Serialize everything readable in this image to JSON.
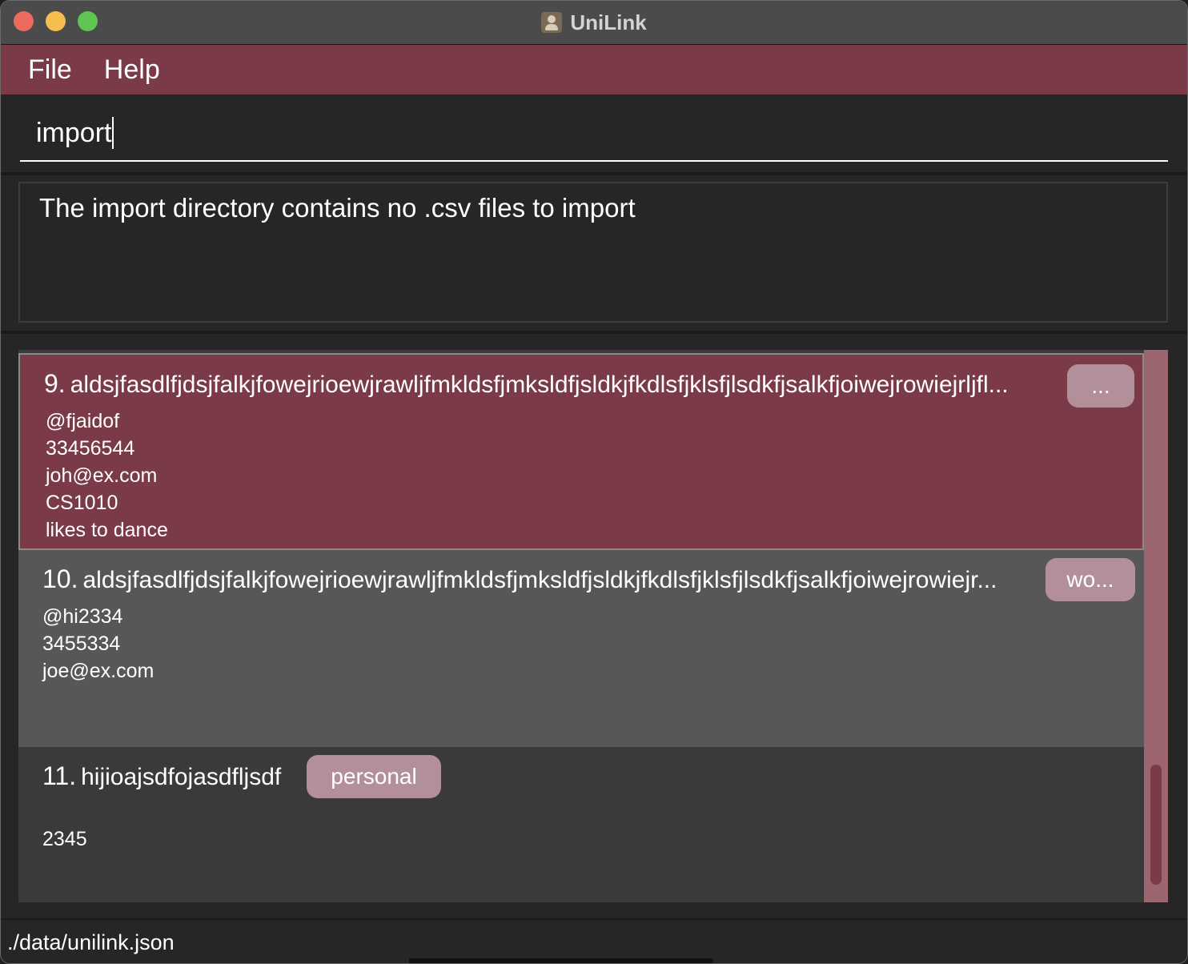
{
  "window": {
    "title": "UniLink"
  },
  "menu": {
    "items": [
      "File",
      "Help"
    ]
  },
  "command": {
    "value": "import"
  },
  "result": {
    "message": "The import directory contains no .csv files to import"
  },
  "persons": [
    {
      "index": "9.",
      "name": "aldsjfasdlfjdsjfalkjfowejrioewjrawljfmkldsfjmksldfjsldkjfkdlsfjklsfjlsdkfjsalkfjoiwejrowiejrljfl...",
      "tag": "...",
      "telegram": "@fjaidof",
      "phone": "33456544",
      "email": "joh@ex.com",
      "module": "CS1010",
      "remark": "likes to dance"
    },
    {
      "index": "10.",
      "name": "aldsjfasdlfjdsjfalkjfowejrioewjrawljfmkldsfjmksldfjsldkjfkdlsfjklsfjlsdkfjsalkfjoiwejrowiejr...",
      "tag": "wo...",
      "telegram": "@hi2334",
      "phone": "3455334",
      "email": "joe@ex.com"
    },
    {
      "index": "11.",
      "name": "hijioajsdfojasdfljsdf",
      "tag": "personal",
      "phone": "2345"
    }
  ],
  "status": {
    "path": "./data/unilink.json"
  },
  "colors": {
    "accent": "#7a3a48",
    "tag": "#b39099",
    "scrollbar": "#9c666e"
  }
}
